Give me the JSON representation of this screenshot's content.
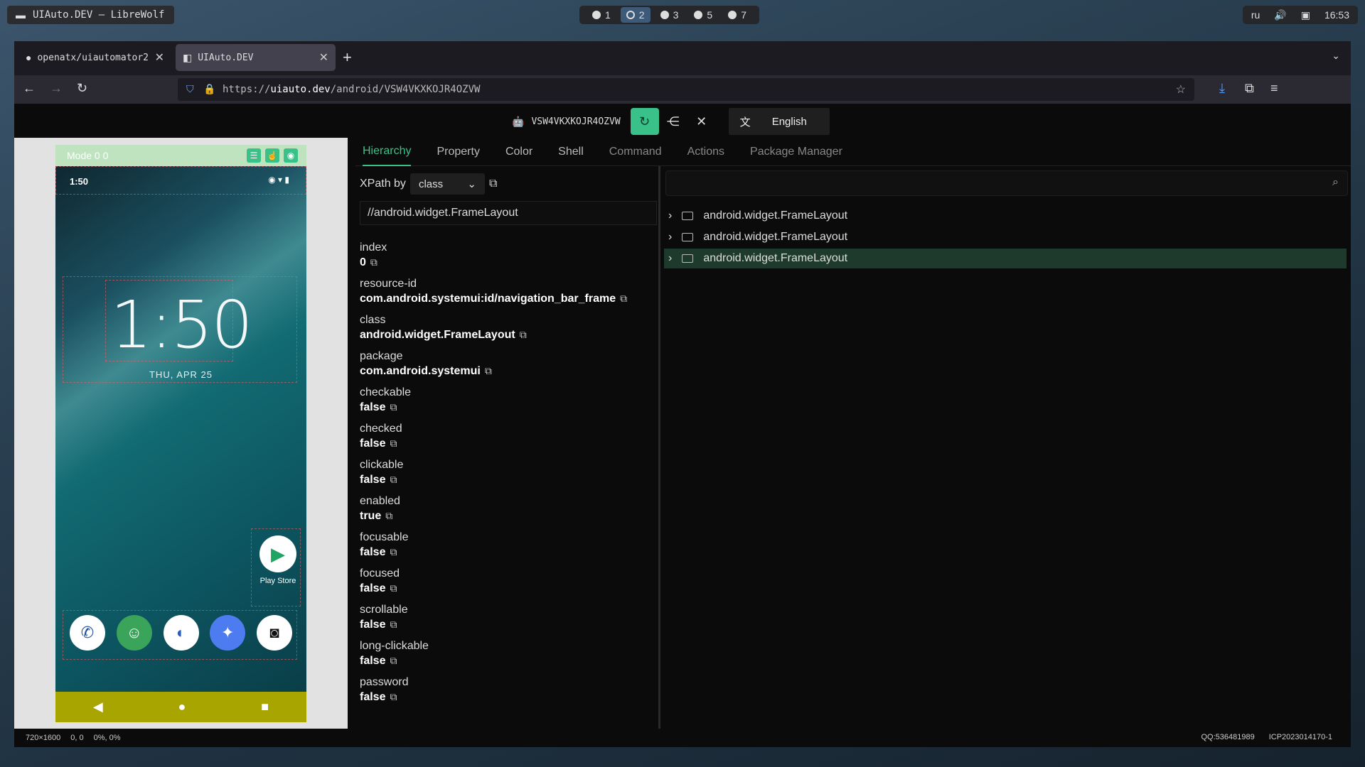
{
  "system": {
    "window_title": "UIAuto.DEV — LibreWolf",
    "workspaces": [
      "1",
      "2",
      "3",
      "5",
      "7"
    ],
    "active_workspace": "2",
    "lang": "ru",
    "time": "16:53"
  },
  "browser": {
    "tabs": [
      {
        "label": "openatx/uiautomator2",
        "active": false
      },
      {
        "label": "UIAuto.DEV",
        "active": true
      }
    ],
    "url_prefix": "https://",
    "url_host": "uiauto.dev",
    "url_path": "/android/VSW4VKXKOJR4OZVW"
  },
  "devbar": {
    "device_id": "VSW4VKXKOJR4OZVW",
    "language": "English"
  },
  "phone": {
    "mode": "Mode 0 0",
    "status_time": "1:50",
    "clock": "1:50",
    "date": "THU, APR 25",
    "playstore_label": "Play Store"
  },
  "inspector": {
    "tabs": [
      "Hierarchy",
      "Property",
      "Color",
      "Shell",
      "Command",
      "Actions",
      "Package Manager"
    ],
    "active_tab": "Hierarchy",
    "xpath_label": "XPath by",
    "xpath_by": "class",
    "xpath_value": "//android.widget.FrameLayout",
    "properties": [
      {
        "key": "index",
        "value": "0"
      },
      {
        "key": "resource-id",
        "value": "com.android.systemui:id/navigation_bar_frame"
      },
      {
        "key": "class",
        "value": "android.widget.FrameLayout"
      },
      {
        "key": "package",
        "value": "com.android.systemui"
      },
      {
        "key": "checkable",
        "value": "false"
      },
      {
        "key": "checked",
        "value": "false"
      },
      {
        "key": "clickable",
        "value": "false"
      },
      {
        "key": "enabled",
        "value": "true"
      },
      {
        "key": "focusable",
        "value": "false"
      },
      {
        "key": "focused",
        "value": "false"
      },
      {
        "key": "scrollable",
        "value": "false"
      },
      {
        "key": "long-clickable",
        "value": "false"
      },
      {
        "key": "password",
        "value": "false"
      }
    ],
    "tree_nodes": [
      {
        "label": "android.widget.FrameLayout",
        "selected": false
      },
      {
        "label": "android.widget.FrameLayout",
        "selected": false
      },
      {
        "label": "android.widget.FrameLayout",
        "selected": true
      }
    ]
  },
  "footer": {
    "resolution": "720×1600",
    "coords": "0, 0",
    "percent": "0%, 0%",
    "qq": "QQ:536481989",
    "icp": "ICP2023014170-1"
  }
}
